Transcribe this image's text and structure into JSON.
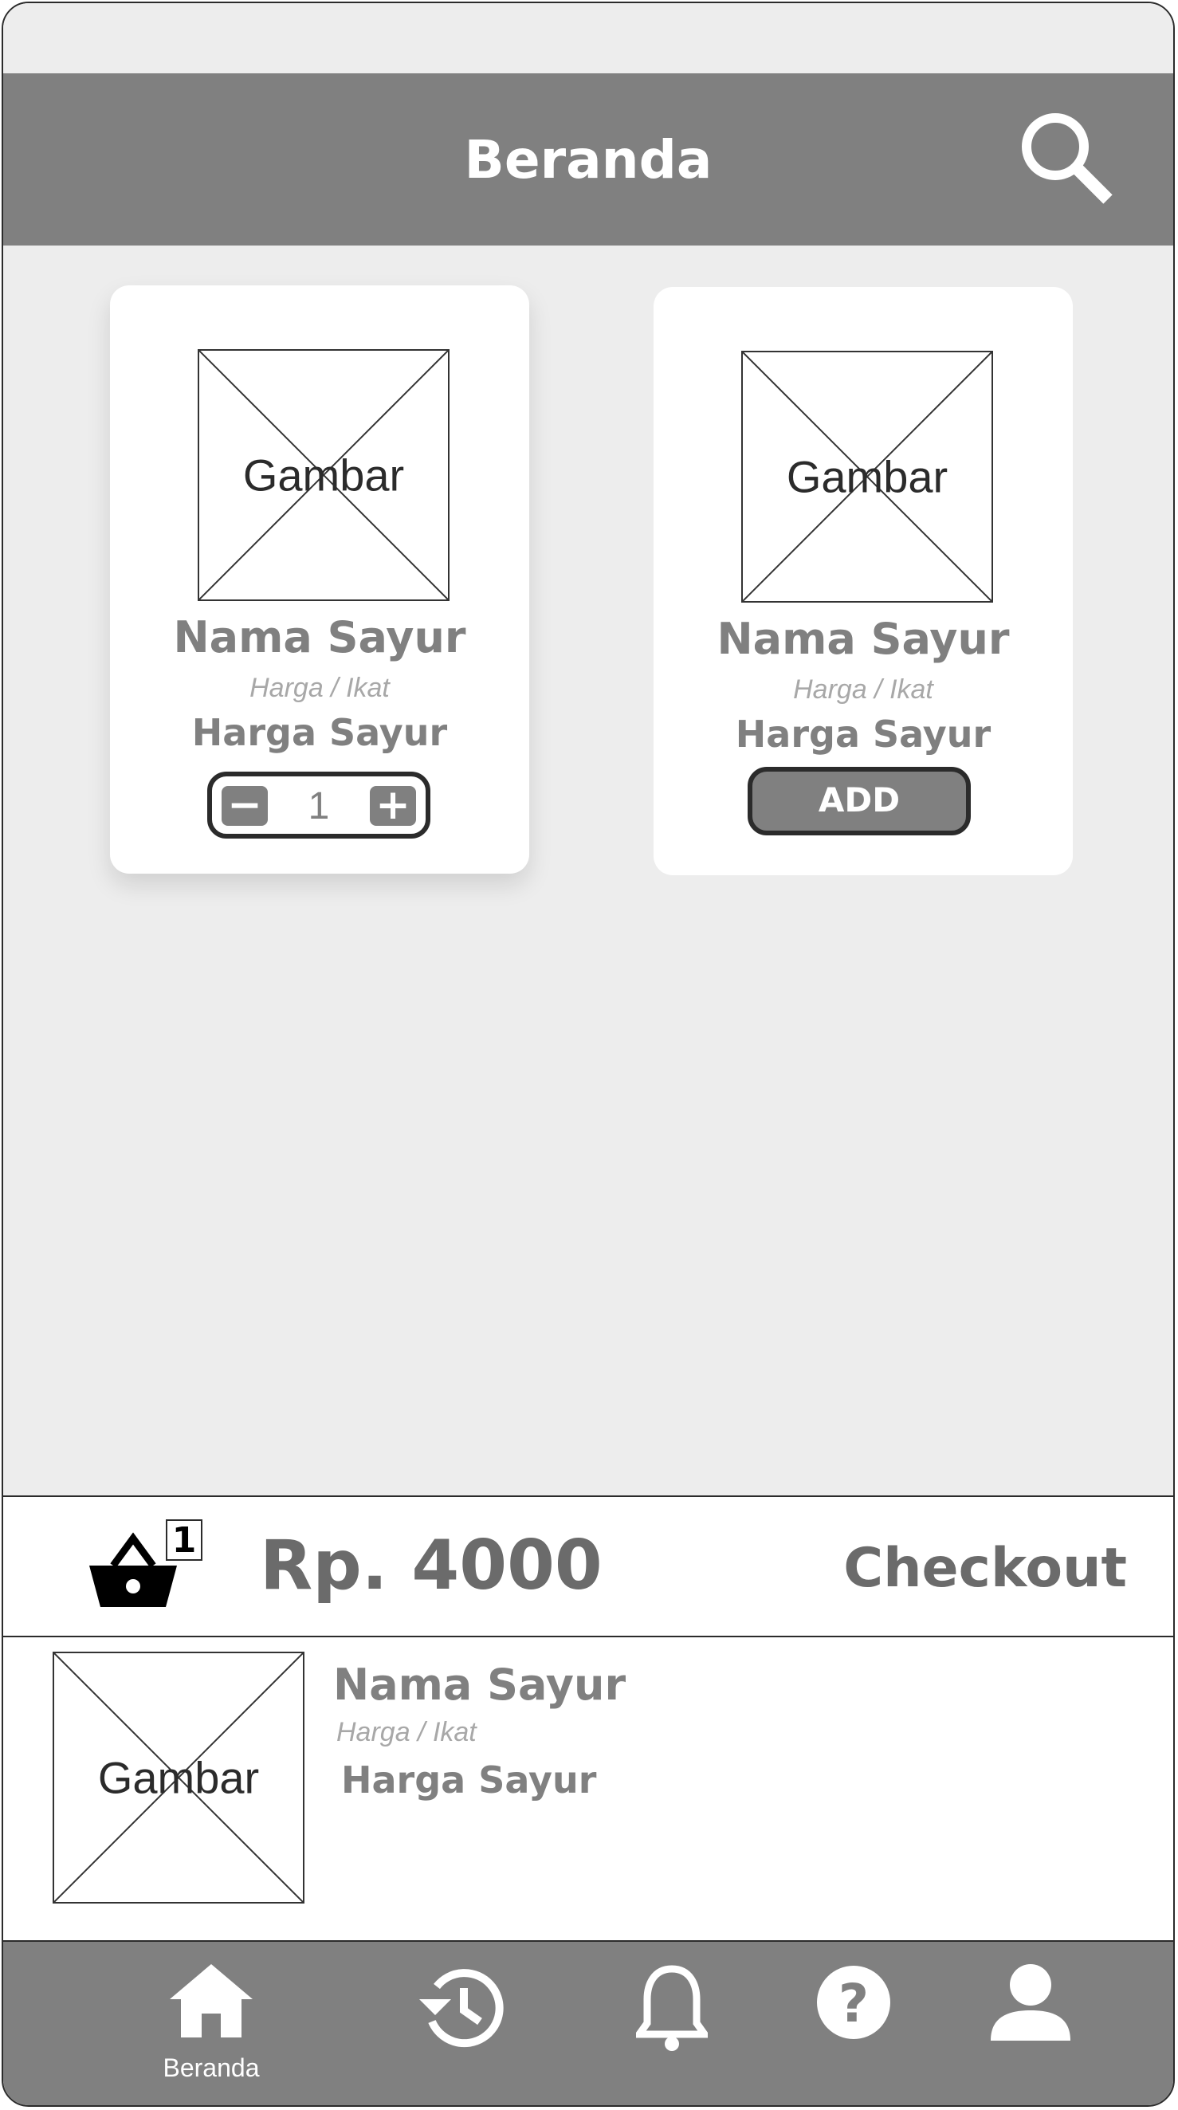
{
  "header": {
    "title": "Beranda",
    "search_icon": "search-icon"
  },
  "products": [
    {
      "image_label": "Gambar",
      "name": "Nama Sayur",
      "unit": "Harga / Ikat",
      "price": "Harga Sayur",
      "control": "stepper",
      "quantity": "1",
      "minus": "−",
      "plus": "+"
    },
    {
      "image_label": "Gambar",
      "name": "Nama Sayur",
      "unit": "Harga / Ikat",
      "price": "Harga Sayur",
      "control": "add",
      "add_label": "ADD"
    }
  ],
  "cart": {
    "icon": "basket-icon",
    "badge_count": "1",
    "total": "Rp. 4000",
    "checkout_label": "Checkout"
  },
  "cart_item": {
    "image_label": "Gambar",
    "name": "Nama Sayur",
    "unit": "Harga / Ikat",
    "price": "Harga Sayur"
  },
  "nav": {
    "items": [
      {
        "icon": "home-icon",
        "label": "Beranda"
      },
      {
        "icon": "history-icon",
        "label": ""
      },
      {
        "icon": "bell-icon",
        "label": ""
      },
      {
        "icon": "help-icon",
        "label": ""
      },
      {
        "icon": "user-icon",
        "label": ""
      }
    ]
  },
  "colors": {
    "header": "#808080",
    "background": "#ededed",
    "text_gray": "#808080",
    "border": "#2b2b2b"
  }
}
